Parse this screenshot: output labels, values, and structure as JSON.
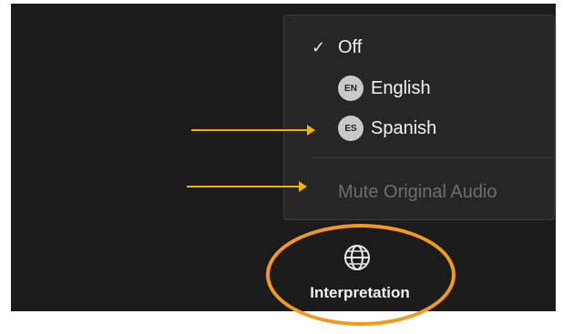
{
  "menu": {
    "items": [
      {
        "label": "Off",
        "checked": true,
        "icon": "checkmark-icon"
      },
      {
        "label": "English",
        "badge": "EN"
      },
      {
        "label": "Spanish",
        "badge": "ES"
      }
    ],
    "mute_label": "Mute Original Audio"
  },
  "toolbar": {
    "interpretation_label": "Interpretation",
    "icon": "globe-icon"
  },
  "annotations": {
    "arrow_color": "#f0b400",
    "highlight_color": "#f39a1c"
  }
}
